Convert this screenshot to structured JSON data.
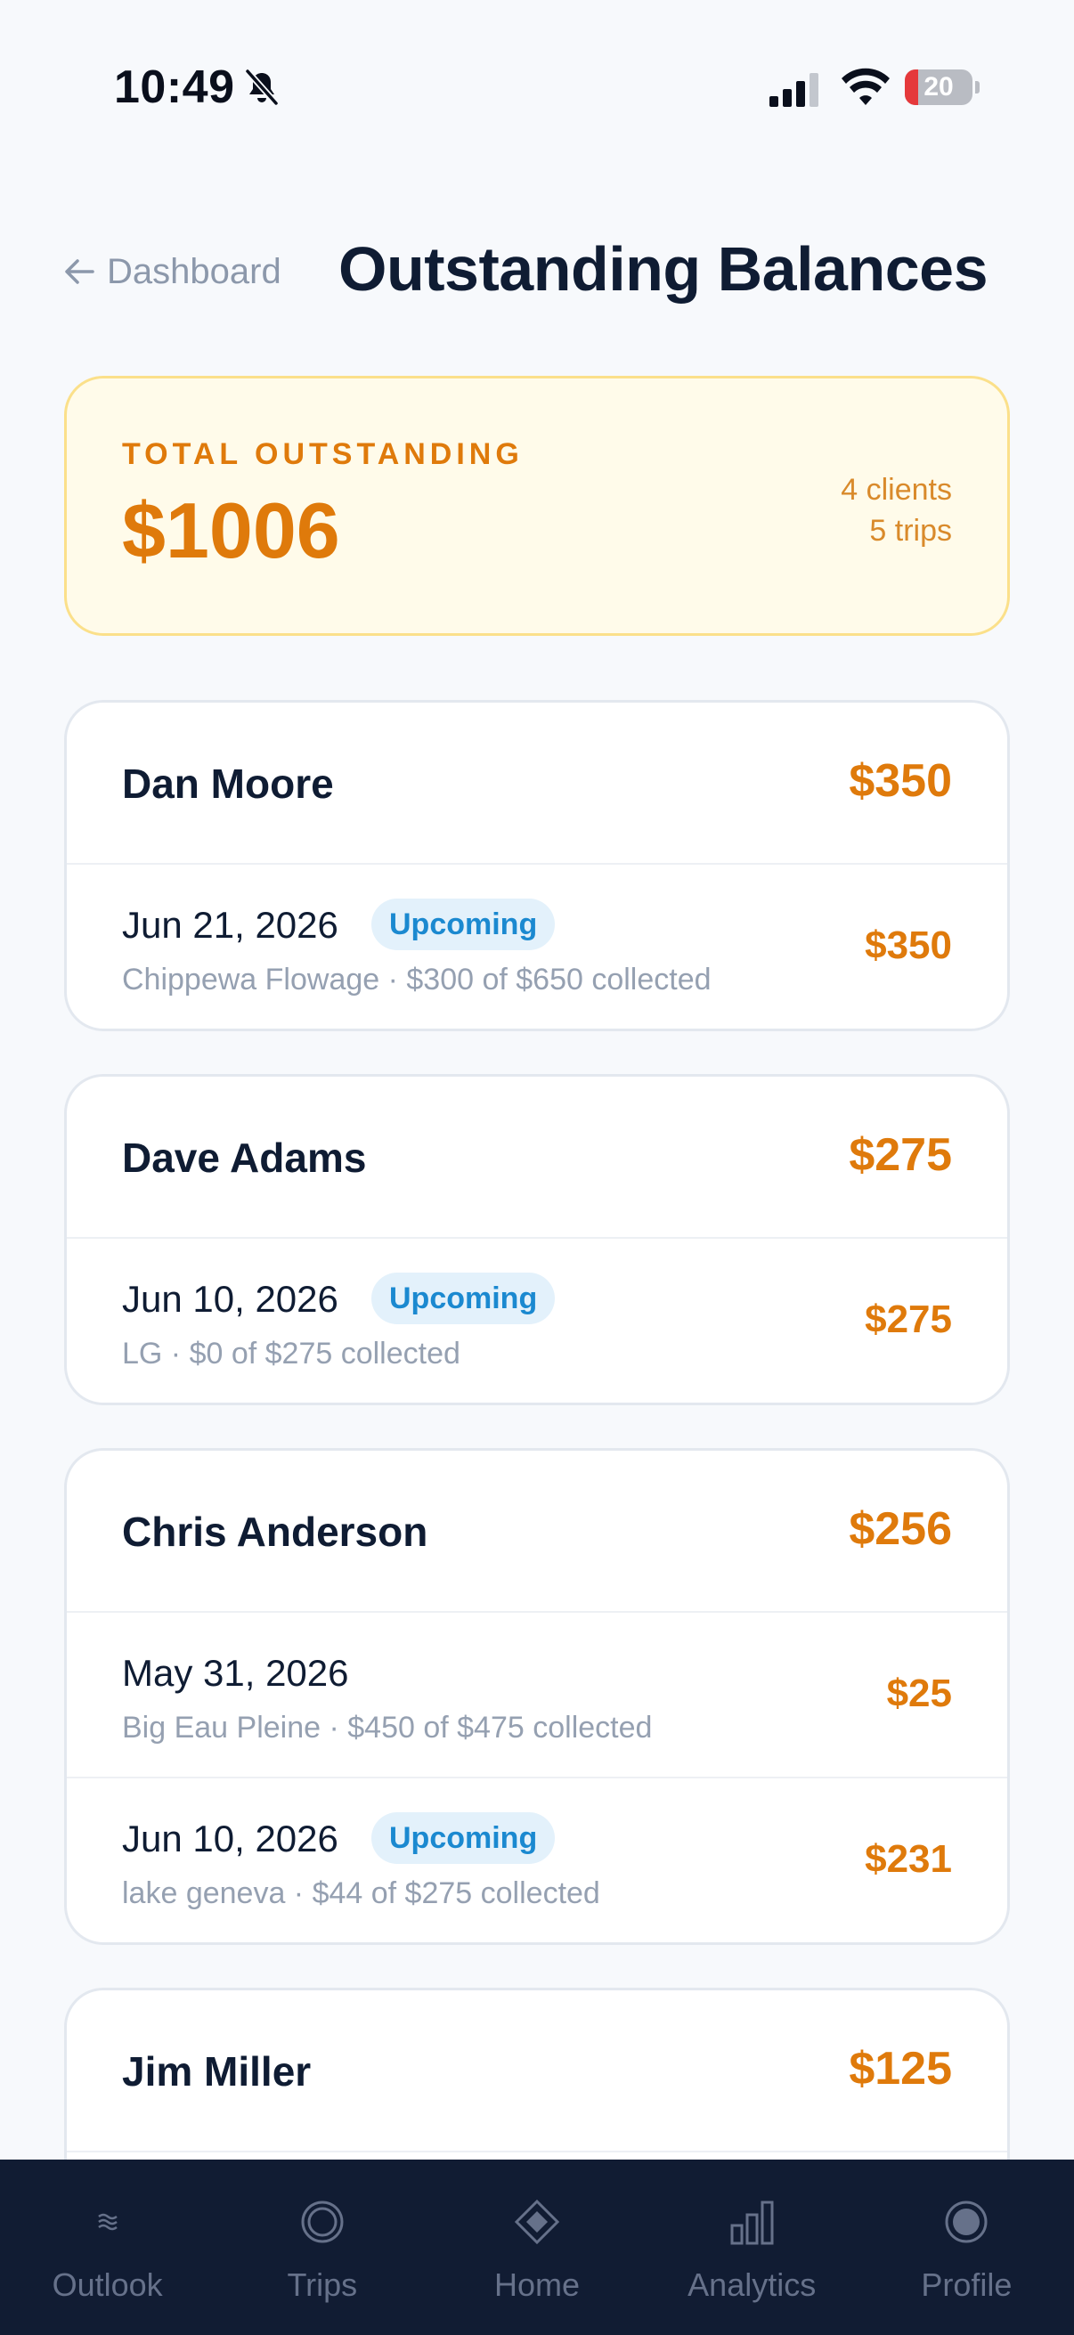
{
  "status_bar": {
    "time": "10:49",
    "battery_level": "20",
    "battery_fraction": 0.2,
    "signal_bars": 3,
    "colors": {
      "battery_low": "#e5393b"
    }
  },
  "header": {
    "back_label": "Dashboard",
    "title": "Outstanding Balances"
  },
  "summary": {
    "label": "TOTAL OUTSTANDING",
    "amount": "$1006",
    "clients": "4 clients",
    "trips": "5 trips"
  },
  "clients": [
    {
      "name": "Dan Moore",
      "total": "$350",
      "trips": [
        {
          "date": "Jun 21, 2026",
          "badge": "Upcoming",
          "desc": "Chippewa Flowage · $300 of $650 collected",
          "amount": "$350"
        }
      ]
    },
    {
      "name": "Dave Adams",
      "total": "$275",
      "trips": [
        {
          "date": "Jun 10, 2026",
          "badge": "Upcoming",
          "desc": "LG · $0 of $275 collected",
          "amount": "$275"
        }
      ]
    },
    {
      "name": "Chris Anderson",
      "total": "$256",
      "trips": [
        {
          "date": "May 31, 2026",
          "badge": "",
          "desc": "Big Eau Pleine · $450 of $475 collected",
          "amount": "$25"
        },
        {
          "date": "Jun 10, 2026",
          "badge": "Upcoming",
          "desc": "lake geneva · $44 of $275 collected",
          "amount": "$231"
        }
      ]
    },
    {
      "name": "Jim Miller",
      "total": "$125",
      "trips": []
    }
  ],
  "nav": {
    "items": [
      {
        "label": "Outlook",
        "icon": "waves-icon"
      },
      {
        "label": "Trips",
        "icon": "ring-icon"
      },
      {
        "label": "Home",
        "icon": "diamond-icon"
      },
      {
        "label": "Analytics",
        "icon": "bar-chart-icon"
      },
      {
        "label": "Profile",
        "icon": "profile-dot-icon"
      }
    ]
  },
  "colors": {
    "accent": "#df7a0b",
    "summary_bg": "#fffbea",
    "badge_bg": "#e3f1fb",
    "badge_text": "#1b89d0",
    "nav_bg": "#111c33",
    "title": "#0f1c33"
  }
}
